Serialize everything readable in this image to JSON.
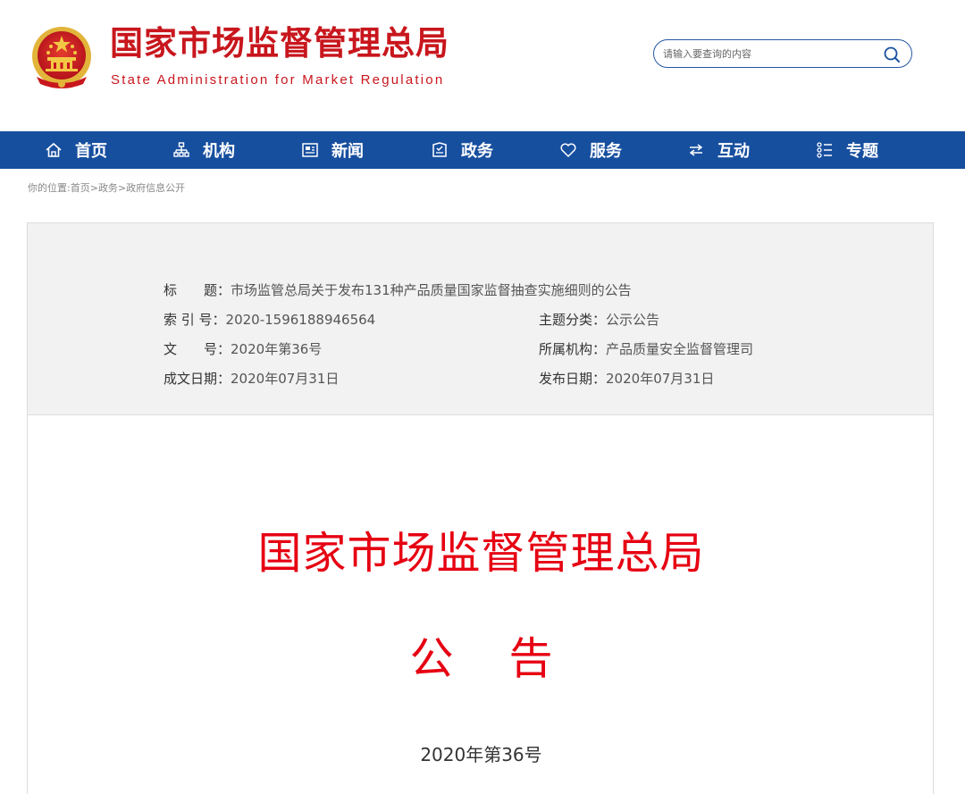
{
  "header": {
    "title": "国家市场监督管理总局",
    "subtitle": "State Administration for Market Regulation",
    "search_placeholder": "请输入要查询的内容",
    "search_icon": "search-icon",
    "brand_color": "#c8161d"
  },
  "nav": {
    "color": "#174f9f",
    "items": [
      {
        "label": "首页",
        "icon": "home-icon"
      },
      {
        "label": "机构",
        "icon": "org-chart-icon"
      },
      {
        "label": "新闻",
        "icon": "newspaper-icon"
      },
      {
        "label": "政务",
        "icon": "briefcase-icon"
      },
      {
        "label": "服务",
        "icon": "heart-icon"
      },
      {
        "label": "互动",
        "icon": "exchange-arrows-icon"
      },
      {
        "label": "专题",
        "icon": "topic-list-icon"
      }
    ]
  },
  "breadcrumb": {
    "prefix": "你的位置:",
    "items": [
      "首页",
      "政务",
      "政府信息公开"
    ],
    "separator": ">"
  },
  "info": {
    "title_label": "标　　题：",
    "title_value": "市场监管总局关于发布131种产品质量国家监督抽查实施细则的公告",
    "index_label": "索 引 号：",
    "index_value": "2020-1596188946564",
    "topic_label": "主题分类：",
    "topic_value": "公示公告",
    "doc_no_label": "文　　号：",
    "doc_no_value": "2020年第36号",
    "org_label": "所属机构：",
    "org_value": "产品质量安全监督管理司",
    "created_label": "成文日期：",
    "created_value": "2020年07月31日",
    "published_label": "发布日期：",
    "published_value": "2020年07月31日"
  },
  "document": {
    "agency": "国家市场监督管理总局",
    "type_char_1": "公",
    "type_char_2": "告",
    "number": "2020年第36号",
    "red_color": "#e60012"
  }
}
